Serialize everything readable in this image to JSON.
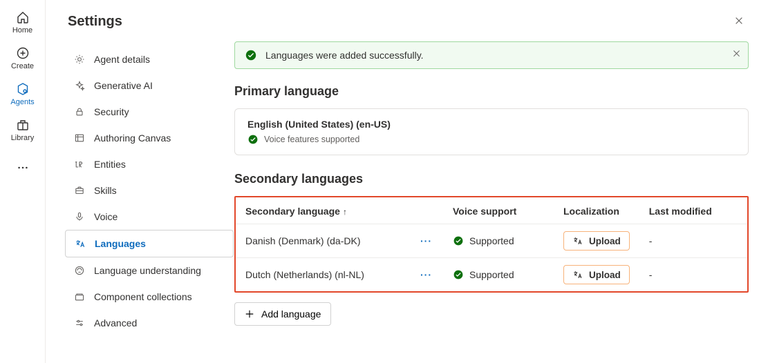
{
  "rail": {
    "items": [
      {
        "label": "Home"
      },
      {
        "label": "Create"
      },
      {
        "label": "Agents"
      },
      {
        "label": "Library"
      }
    ]
  },
  "page": {
    "title": "Settings"
  },
  "settings_nav": {
    "items": [
      {
        "label": "Agent details"
      },
      {
        "label": "Generative AI"
      },
      {
        "label": "Security"
      },
      {
        "label": "Authoring Canvas"
      },
      {
        "label": "Entities"
      },
      {
        "label": "Skills"
      },
      {
        "label": "Voice"
      },
      {
        "label": "Languages"
      },
      {
        "label": "Language understanding"
      },
      {
        "label": "Component collections"
      },
      {
        "label": "Advanced"
      }
    ],
    "active_index": 7
  },
  "alert": {
    "message": "Languages were added successfully."
  },
  "primary": {
    "heading": "Primary language",
    "name": "English (United States) (en-US)",
    "status": "Voice features supported"
  },
  "secondary": {
    "heading": "Secondary languages",
    "columns": {
      "language": "Secondary language",
      "voice": "Voice support",
      "localization": "Localization",
      "modified": "Last modified"
    },
    "upload_label": "Upload",
    "rows": [
      {
        "language": "Danish (Denmark) (da-DK)",
        "voice": "Supported",
        "modified": "-"
      },
      {
        "language": "Dutch (Netherlands) (nl-NL)",
        "voice": "Supported",
        "modified": "-"
      }
    ],
    "add_label": "Add language"
  }
}
